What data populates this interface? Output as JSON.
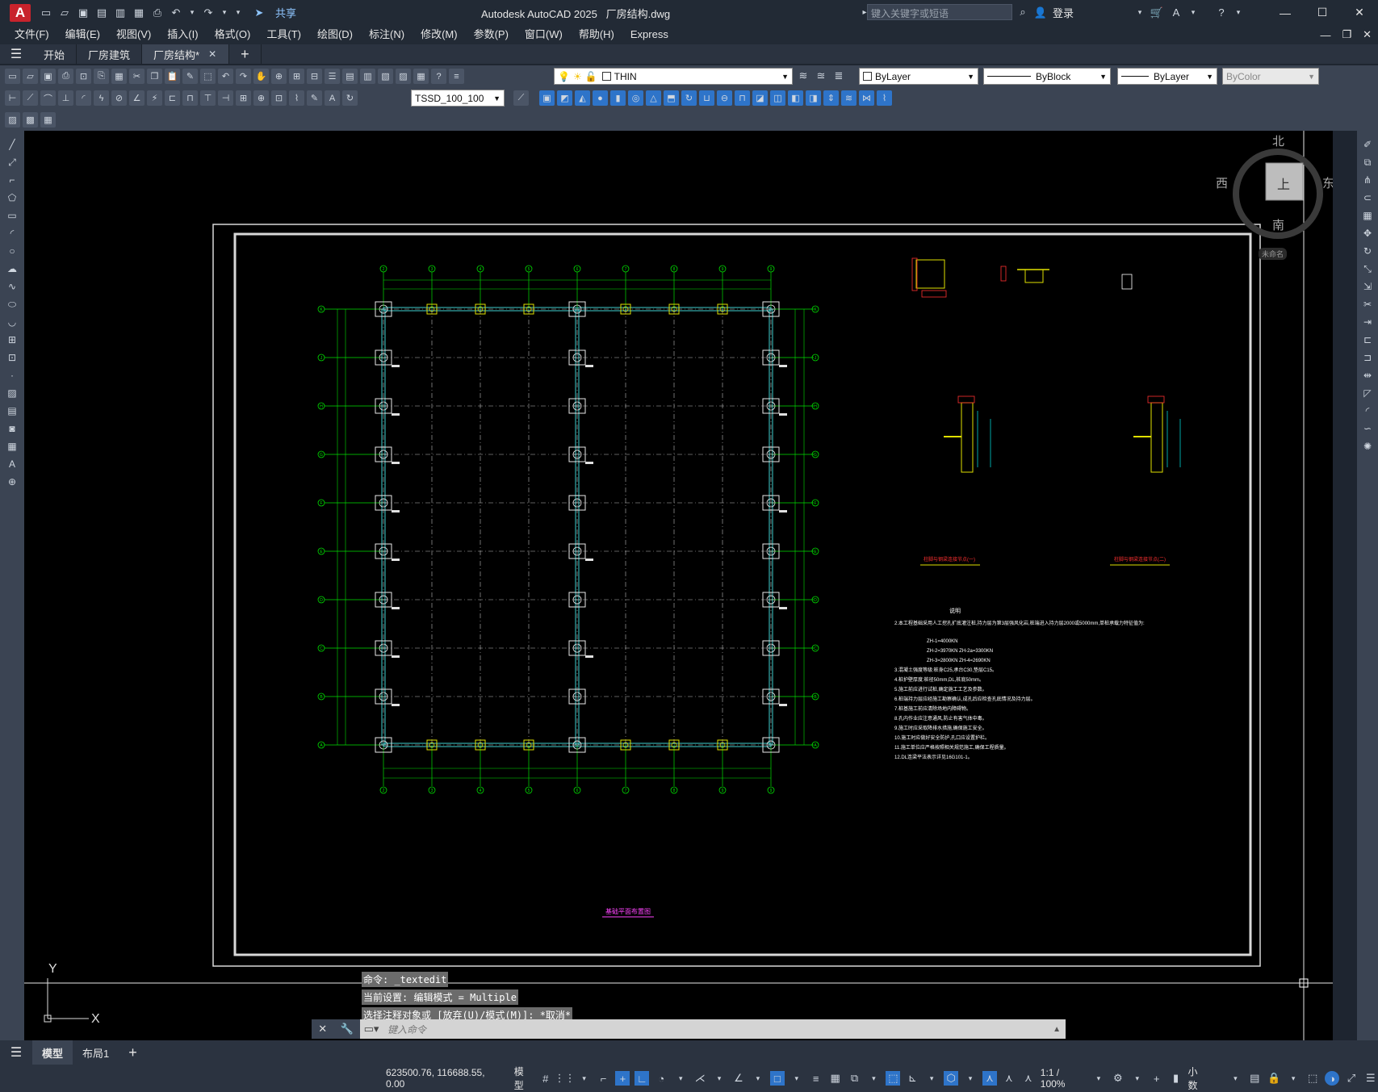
{
  "app": {
    "title": "Autodesk AutoCAD 2025",
    "file": "厂房结构.dwg",
    "share": "共享",
    "search_placeholder": "键入关键字或短语",
    "login": "登录"
  },
  "menu": [
    "文件(F)",
    "编辑(E)",
    "视图(V)",
    "插入(I)",
    "格式(O)",
    "工具(T)",
    "绘图(D)",
    "标注(N)",
    "修改(M)",
    "参数(P)",
    "窗口(W)",
    "帮助(H)",
    "Express"
  ],
  "tabs": [
    {
      "label": "开始",
      "active": false
    },
    {
      "label": "厂房建筑",
      "active": false
    },
    {
      "label": "厂房结构*",
      "active": true
    }
  ],
  "toolbar": {
    "layer": "THIN",
    "color": "ByLayer",
    "linetype": "ByBlock",
    "lineweight": "ByLayer",
    "plotstyle": "ByColor",
    "dimstyle": "TSSD_100_100"
  },
  "navcube": {
    "north": "北",
    "south": "南",
    "east": "东",
    "west": "西",
    "top": "上",
    "wcs": "未命名"
  },
  "drawing": {
    "grid_top": [
      "2",
      "3",
      "4",
      "5",
      "6",
      "7",
      "8",
      "9"
    ],
    "grid_left": [
      "K",
      "J",
      "H",
      "G",
      "F",
      "E",
      "D",
      "C",
      "B",
      "A"
    ],
    "plan_title": "基础平面布置图",
    "detail1": "柱脚与钢梁连接节点(一)",
    "detail2": "柱脚与钢梁连接节点(二)",
    "notes_title": "说明",
    "notes": [
      "2.本工程基础采用人工挖孔扩底灌注桩,持力层为第3层强风化岩,桩端进入持力层2000或5000mm,单桩承载力特征值为:",
      "ZH-1=4000KN",
      "ZH-2=3970KN   ZH-2a=3300KN",
      "ZH-3=2800KN   ZH-4=2690KN",
      "3.混凝土强度等级:桩身C25,承台C30,垫层C15。",
      "4.桩护壁厚度:桩径50mm,DL,桩底50mm。",
      "5.施工前应进行试桩,确定施工工艺及参数。",
      "6.桩端持力层应经施工勘察确认,成孔后应检查孔底情况及持力层。",
      "7.桩基施工前应清除场地内障碍物。",
      "8.孔内作业应注意通风,防止有害气体中毒。",
      "9.施工时应采取降排水措施,确保施工安全。",
      "10.施工时应做好安全防护,孔口应设置护栏。",
      "11.施工单位应严格按照相关规范施工,确保工程质量。",
      "12.DL连梁平法表示详见16G101-1。"
    ]
  },
  "command": {
    "history": [
      "命令: _textedit",
      "当前设置: 编辑模式 = Multiple",
      "选择注释对象或 [放弃(U)/模式(M)]: *取消*"
    ],
    "placeholder": "键入命令"
  },
  "layouts": [
    {
      "label": "模型",
      "active": true
    },
    {
      "label": "布局1",
      "active": false
    }
  ],
  "status": {
    "coords": "623500.76, 116688.55, 0.00",
    "space": "模型",
    "scale": "1:1 / 100%",
    "units": "小数"
  }
}
